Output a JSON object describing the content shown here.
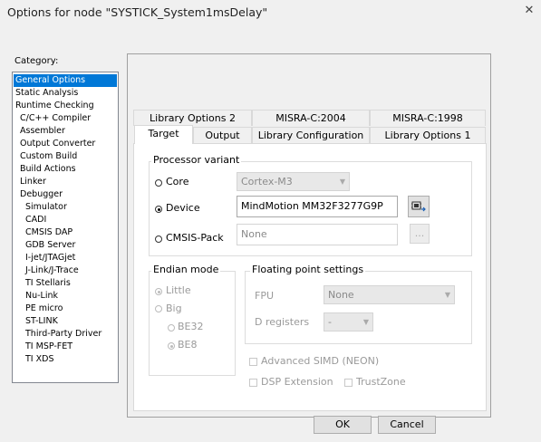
{
  "window": {
    "title": "Options for node \"SYSTICK_System1msDelay\""
  },
  "category": {
    "label": "Category:",
    "items": [
      {
        "label": "General Options",
        "selected": true
      },
      {
        "label": "Static Analysis"
      },
      {
        "label": "Runtime Checking"
      },
      {
        "label": "C/C++ Compiler"
      },
      {
        "label": "Assembler"
      },
      {
        "label": "Output Converter"
      },
      {
        "label": "Custom Build"
      },
      {
        "label": "Build Actions"
      },
      {
        "label": "Linker"
      },
      {
        "label": "Debugger"
      },
      {
        "label": "Simulator"
      },
      {
        "label": "CADI"
      },
      {
        "label": "CMSIS DAP"
      },
      {
        "label": "GDB Server"
      },
      {
        "label": "I-jet/JTAGjet"
      },
      {
        "label": "J-Link/J-Trace"
      },
      {
        "label": "TI Stellaris"
      },
      {
        "label": "Nu-Link"
      },
      {
        "label": "PE micro"
      },
      {
        "label": "ST-LINK"
      },
      {
        "label": "Third-Party Driver"
      },
      {
        "label": "TI MSP-FET"
      },
      {
        "label": "TI XDS"
      }
    ]
  },
  "tabs": {
    "row1": [
      "Library Options 2",
      "MISRA-C:2004",
      "MISRA-C:1998"
    ],
    "row2": [
      "Target",
      "Output",
      "Library Configuration",
      "Library Options 1"
    ],
    "active": "Target"
  },
  "processor": {
    "group_label": "Processor variant",
    "core_label": "Core",
    "core_value": "Cortex-M3",
    "device_label": "Device",
    "device_value": "MindMotion MM32F3277G9P",
    "cmsis_label": "CMSIS-Pack",
    "cmsis_value": "None",
    "cmsis_btn": "...",
    "selected": "Device"
  },
  "endian": {
    "group_label": "Endian mode",
    "little_label": "Little",
    "big_label": "Big",
    "be32_label": "BE32",
    "be8_label": "BE8"
  },
  "fp": {
    "group_label": "Floating point settings",
    "fpu_label": "FPU",
    "fpu_value": "None",
    "dreg_label": "D registers",
    "dreg_value": "-"
  },
  "options": {
    "simd_label": "Advanced SIMD (NEON)",
    "dsp_label": "DSP Extension",
    "trustzone_label": "TrustZone"
  },
  "buttons": {
    "ok": "OK",
    "cancel": "Cancel"
  },
  "icons": {
    "close": "close-icon",
    "device_select": "device-select-icon"
  }
}
